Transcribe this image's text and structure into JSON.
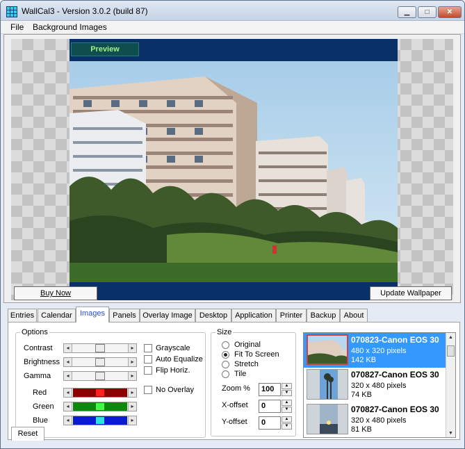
{
  "window": {
    "title": "WallCal3 - Version 3.0.2 (build 87)",
    "controls": {
      "minimize": "▁",
      "maximize": "□",
      "close": "✕"
    }
  },
  "menubar": {
    "items": [
      "File",
      "Background Images"
    ]
  },
  "preview": {
    "label": "Preview",
    "buy_now": "Buy Now",
    "update_wallpaper": "Update Wallpaper"
  },
  "tabs": [
    "Entries",
    "Calendar",
    "Images",
    "Panels",
    "Overlay Image",
    "Desktop",
    "Application",
    "Printer",
    "Backup",
    "About"
  ],
  "active_tab": "Images",
  "options": {
    "group_label": "Options",
    "sliders": [
      {
        "label": "Contrast",
        "value": 0.5
      },
      {
        "label": "Brightness",
        "value": 0.5
      },
      {
        "label": "Gamma",
        "value": 0.5
      }
    ],
    "color_sliders": [
      {
        "label": "Red",
        "value": 0.5,
        "color": "#8b0000",
        "thumb_color": "#ff2020"
      },
      {
        "label": "Green",
        "value": 0.5,
        "color": "#0a8a0a",
        "thumb_color": "#40ff40"
      },
      {
        "label": "Blue",
        "value": 0.5,
        "color": "#0a1ad0",
        "thumb_color": "#30e0e0"
      }
    ],
    "checkboxes": [
      {
        "label": "Grayscale",
        "checked": false
      },
      {
        "label": "Auto Equalize",
        "checked": false
      },
      {
        "label": "Flip Horiz.",
        "checked": false
      },
      {
        "label": "No Overlay",
        "checked": false
      }
    ],
    "reset": "Reset"
  },
  "size": {
    "group_label": "Size",
    "radios": [
      {
        "label": "Original",
        "checked": false
      },
      {
        "label": "Fit To Screen",
        "checked": true
      },
      {
        "label": "Stretch",
        "checked": false
      },
      {
        "label": "Tile",
        "checked": false
      }
    ],
    "zoom_label": "Zoom %",
    "zoom_value": "100",
    "xoffset_label": "X-offset",
    "xoffset_value": "0",
    "yoffset_label": "Y-offset",
    "yoffset_value": "0"
  },
  "images": [
    {
      "name": "070823-Canon EOS 30",
      "dims": "480 x 320 pixels",
      "size": "142 KB",
      "selected": true
    },
    {
      "name": "070827-Canon EOS 30",
      "dims": "320 x 480 pixels",
      "size": "74 KB",
      "selected": false
    },
    {
      "name": "070827-Canon EOS 30",
      "dims": "320 x 480 pixels",
      "size": "81 KB",
      "selected": false
    }
  ]
}
